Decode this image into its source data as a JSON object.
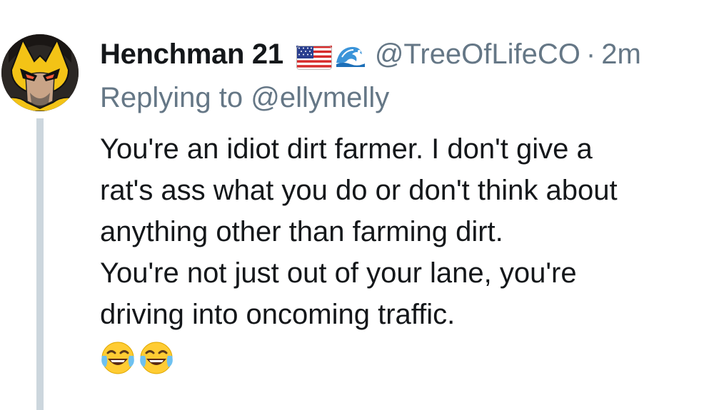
{
  "tweet": {
    "display_name": "Henchman 21",
    "badges": [
      "us-flag-icon",
      "water-wave-icon"
    ],
    "handle": "@TreeOfLifeCO",
    "separator": "·",
    "timestamp": "2m",
    "replying_prefix": "Replying to ",
    "replying_handle": "@ellymelly",
    "body_lines": [
      "You're an idiot dirt farmer. I don't give a",
      "rat's ass what you do or don't think about",
      "anything other than farming dirt.",
      "You're not just out of your lane, you're",
      "driving into oncoming traffic."
    ],
    "emojis": [
      "face-with-tears-of-joy-icon",
      "face-with-tears-of-joy-icon"
    ]
  },
  "colors": {
    "text_primary": "#14171a",
    "text_secondary": "#657786",
    "thread_line": "#ccd6dd",
    "background": "#ffffff"
  }
}
